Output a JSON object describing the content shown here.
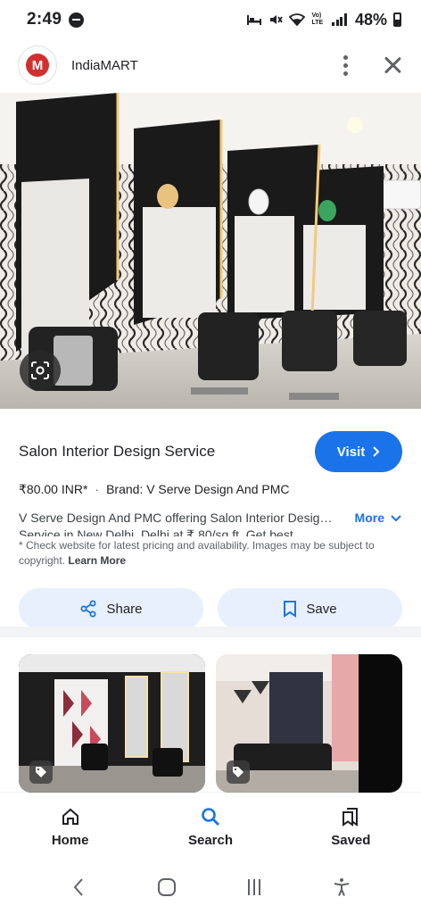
{
  "status_bar": {
    "time": "2:49",
    "battery": "48%",
    "network": "Vo) LTE"
  },
  "app": {
    "title": "IndiaMART",
    "logo_letter": "M",
    "brand_color": "#d32f2f"
  },
  "product": {
    "title": "Salon Interior Design Service",
    "visit_label": "Visit",
    "price": "₹80.00 INR*",
    "brand": "Brand: V Serve Design And PMC",
    "description": "V Serve Design And PMC offering Salon Interior Design Service in New Delhi, Delhi at ₹ 80/sq ft. Get best",
    "description_cut": "Service in New Delhi, Delhi at ₹ 80/sq ft. Get best",
    "more_label": "More",
    "disclaimer": "* Check website for latest pricing and availability. Images may be subject to copyright.",
    "learn_more": "Learn More",
    "share_label": "Share",
    "save_label": "Save"
  },
  "bottom_nav": {
    "items": [
      {
        "label": "Home",
        "icon": "home-icon"
      },
      {
        "label": "Search",
        "icon": "search-icon"
      },
      {
        "label": "Saved",
        "icon": "bookmarks-icon"
      }
    ],
    "active": "Search"
  },
  "colors": {
    "accent": "#1a73e8",
    "chip_bg": "#e8f0fe"
  }
}
